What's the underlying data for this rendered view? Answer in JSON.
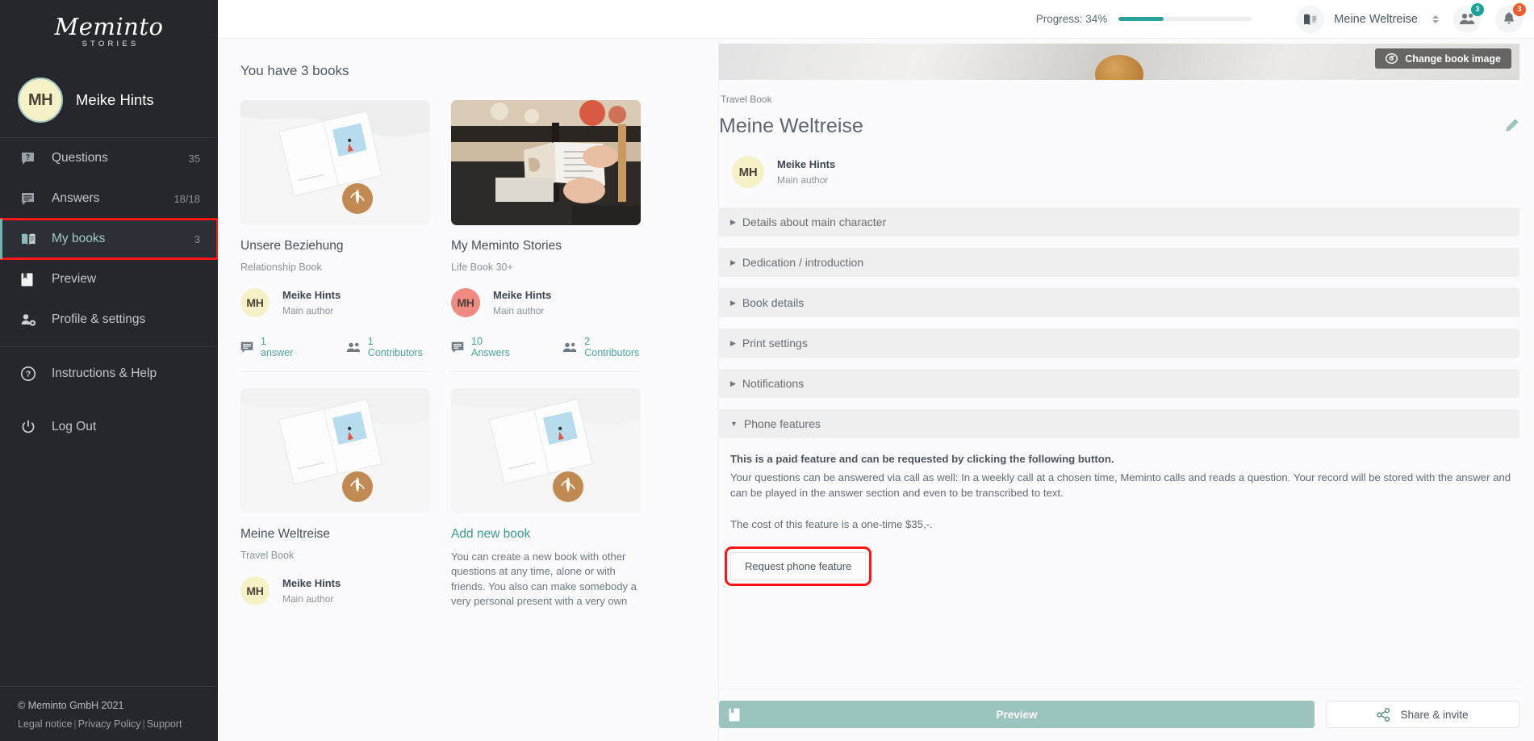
{
  "sidebar": {
    "logo_main": "Meminto",
    "logo_sub": "STORIES",
    "user": {
      "initials": "MH",
      "name": "Meike Hints"
    },
    "nav": [
      {
        "label": "Questions",
        "count": "35",
        "icon": "question-bubble-icon"
      },
      {
        "label": "Answers",
        "count": "18/18",
        "icon": "answers-bubble-icon"
      },
      {
        "label": "My books",
        "count": "3",
        "icon": "open-book-icon"
      },
      {
        "label": "Preview",
        "count": "",
        "icon": "bookmark-icon"
      },
      {
        "label": "Profile & settings",
        "count": "",
        "icon": "user-gear-icon"
      },
      {
        "label": "Instructions & Help",
        "count": "",
        "icon": "help-circle-icon"
      },
      {
        "label": "Log Out",
        "count": "",
        "icon": "power-icon"
      }
    ],
    "footer": {
      "copyright": "© Meminto GmbH 2021",
      "legal": "Legal notice",
      "privacy": "Privacy Policy",
      "support": "Support",
      "separator": "|"
    }
  },
  "topbar": {
    "progress_label": "Progress: 34%",
    "progress_percent": 34,
    "progress_color": "#2ba197",
    "book_selector": {
      "name": "Meine Weltreise",
      "icon": "open-book-icon"
    },
    "contacts": {
      "icon": "people-icon",
      "badge": "3",
      "badge_color": "#19a398"
    },
    "notifications": {
      "icon": "bell-icon",
      "badge": "3",
      "badge_color": "#ef5c2b"
    }
  },
  "books_panel": {
    "heading": "You have 3 books",
    "cards": [
      {
        "title": "Unsere Beziehung",
        "type": "Relationship Book",
        "author_initials": "MH",
        "author_avatar_color": "#f5f2c8",
        "author_name": "Meike Hints",
        "author_role": "Main author",
        "answers": "1 answer",
        "contributors": "1 Contributors",
        "image": "open-book-on-white-bed-with-latte"
      },
      {
        "title": "My Meminto Stories",
        "type": "Life Book 30+",
        "author_initials": "MH",
        "author_avatar_color": "#f08a83",
        "author_name": "Meike Hints",
        "author_role": "Main author",
        "answers": "10 Answers",
        "contributors": "2 Contributors",
        "image": "hands-holding-open-notebook-in-cafe"
      },
      {
        "title": "Meine Weltreise",
        "type": "Travel Book",
        "author_initials": "MH",
        "author_avatar_color": "#f5f2c8",
        "author_name": "Meike Hints",
        "author_role": "Main author",
        "answers": "",
        "contributors": "",
        "image": "open-book-on-white-bed-with-latte"
      }
    ],
    "add_card": {
      "title": "Add new book",
      "description": "You can create a new book with other questions at any time, alone or with friends. You also can make somebody a very personal present with a very own",
      "image": "open-book-on-white-bed-with-latte"
    }
  },
  "detail": {
    "change_image_button": "Change book image",
    "breadcrumb": "Travel Book",
    "title": "Meine Weltreise",
    "author": {
      "initials": "MH",
      "name": "Meike Hints",
      "role": "Main author",
      "avatar_color": "#f5f2c8"
    },
    "sections": [
      {
        "label": "Details about main character",
        "open": false
      },
      {
        "label": "Dedication / introduction",
        "open": false
      },
      {
        "label": "Book details",
        "open": false
      },
      {
        "label": "Print settings",
        "open": false
      },
      {
        "label": "Notifications",
        "open": false
      },
      {
        "label": "Phone features",
        "open": true
      }
    ],
    "phone_features": {
      "headline": "This is a paid feature and can be requested by clicking the following button.",
      "body": "Your questions can be answered via call as well: In a weekly call at a chosen time, Meminto calls and reads a question. Your record will be stored with the answer and can be played in the answer section and even to be transcribed to text.",
      "cost": "The cost of this feature is a one-time $35,-.",
      "request_button": "Request phone feature"
    },
    "footer": {
      "preview_button": "Preview",
      "share_button": "Share & invite"
    }
  },
  "highlights": {
    "color": "#ff1414",
    "targets": [
      "sidebar-item-my-books",
      "request-phone-feature-button"
    ]
  }
}
